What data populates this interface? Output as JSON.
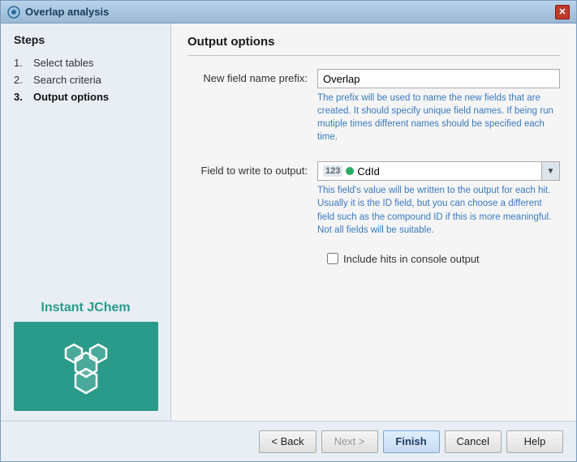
{
  "window": {
    "title": "Overlap analysis",
    "close_label": "✕"
  },
  "sidebar": {
    "title": "Steps",
    "steps": [
      {
        "number": "1.",
        "label": "Select tables",
        "active": false
      },
      {
        "number": "2.",
        "label": "Search criteria",
        "active": false
      },
      {
        "number": "3.",
        "label": "Output options",
        "active": true
      }
    ],
    "brand_label": "Instant JChem"
  },
  "content": {
    "title": "Output options",
    "fields": {
      "prefix_label": "New field name prefix:",
      "prefix_value": "Overlap",
      "prefix_hint": "The prefix will be used to name the new fields that are created. It should specify unique field names. If being run mutiple times different names should be specified each time.",
      "field_label": "Field to write to output:",
      "field_value": "CdId",
      "field_badge": "123",
      "field_hint": "This field's value will be written to the output for each hit. Usually it is the ID field, but you can choose a different field such as the compound ID if this is more meaningful. Not all fields will be suitable.",
      "checkbox_label": "Include hits in console output",
      "checkbox_checked": false
    }
  },
  "footer": {
    "back_label": "< Back",
    "next_label": "Next >",
    "finish_label": "Finish",
    "cancel_label": "Cancel",
    "help_label": "Help"
  }
}
